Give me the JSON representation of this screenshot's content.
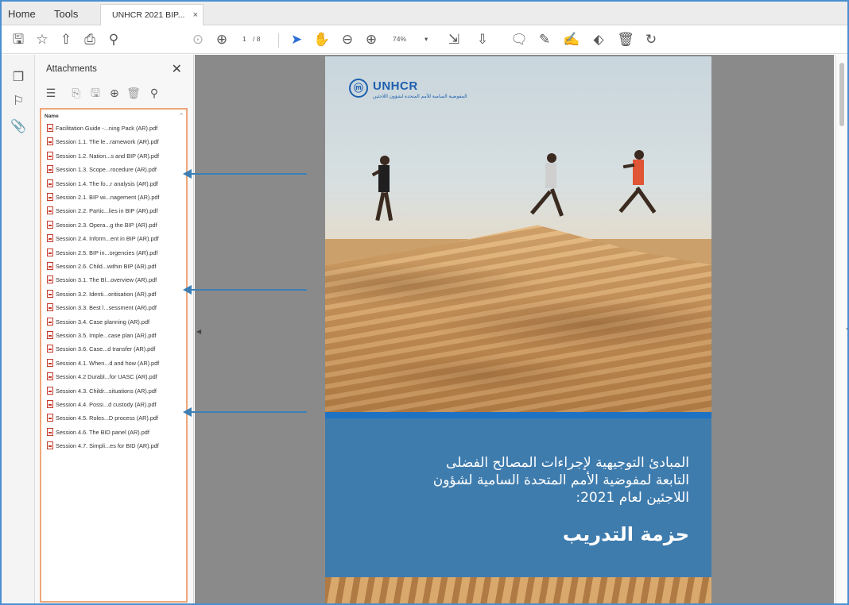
{
  "tabs": {
    "home": "Home",
    "tools": "Tools",
    "document": "UNHCR 2021 BIP...",
    "close": "×"
  },
  "toolbar": {
    "page_current": "1",
    "page_total": "/ 8",
    "zoom": "74%",
    "zoom_caret": "▾"
  },
  "panel": {
    "title": "Attachments",
    "close": "✕",
    "column_name": "Name"
  },
  "files": [
    "Facilitation Guide -...ning Pack (AR).pdf",
    "Session 1.1. The le...ramework (AR).pdf",
    "Session 1.2. Nation...s and BIP (AR).pdf",
    "Session 1.3. Scope...rocedure (AR).pdf",
    "Session 1.4. The fo...r analysis (AR).pdf",
    "Session 2.1. BIP wi...nagement (AR).pdf",
    "Session 2.2. Partic...lies in BIP (AR).pdf",
    "Session 2.3. Opera...g the BIP (AR).pdf",
    "Session 2.4. Inform...ent in BIP (AR).pdf",
    "Session 2.5. BIP in...orgencies (AR).pdf",
    "Session 2.6. Child...within BIP (AR).pdf",
    "Session 3.1. The Bl...overview (AR).pdf",
    "Session 3.2. Identi...oritisation (AR).pdf",
    "Session 3.3. Best l...sessment (AR).pdf",
    "Session 3.4. Case planning (AR).pdf",
    "Session 3.5. Imple...case plan (AR).pdf",
    "Session 3.6. Case...d transfer (AR).pdf",
    "Session 4.1. When...d and how (AR).pdf",
    "Session 4.2 Durabl...for UASC (AR).pdf",
    "Session 4.3. Childr...situations (AR).pdf",
    "Session 4.4. Possi...d custody (AR).pdf",
    "Session 4.5. Roles...D process (AR).pdf",
    "Session 4.6. The BID panel (AR).pdf",
    "Session 4.7. Simpli...es for BID (AR).pdf"
  ],
  "document": {
    "logo_text": "UNHCR",
    "logo_sub": "المفوضية السامية للأمم المتحدة لشؤون اللاجئين",
    "title": "المبادئ التوجيهية لإجراءات المصالح الفضلى التابعة لمفوضية الأمم المتحدة السامية لشؤون اللاجئين لعام 2021:",
    "subtitle": "حزمة التدريب"
  },
  "colors": {
    "accent": "#2b6fd6",
    "panel_border": "#f0a67a",
    "arrow": "#3d7fb4",
    "doc_blue": "#3f7cae"
  }
}
